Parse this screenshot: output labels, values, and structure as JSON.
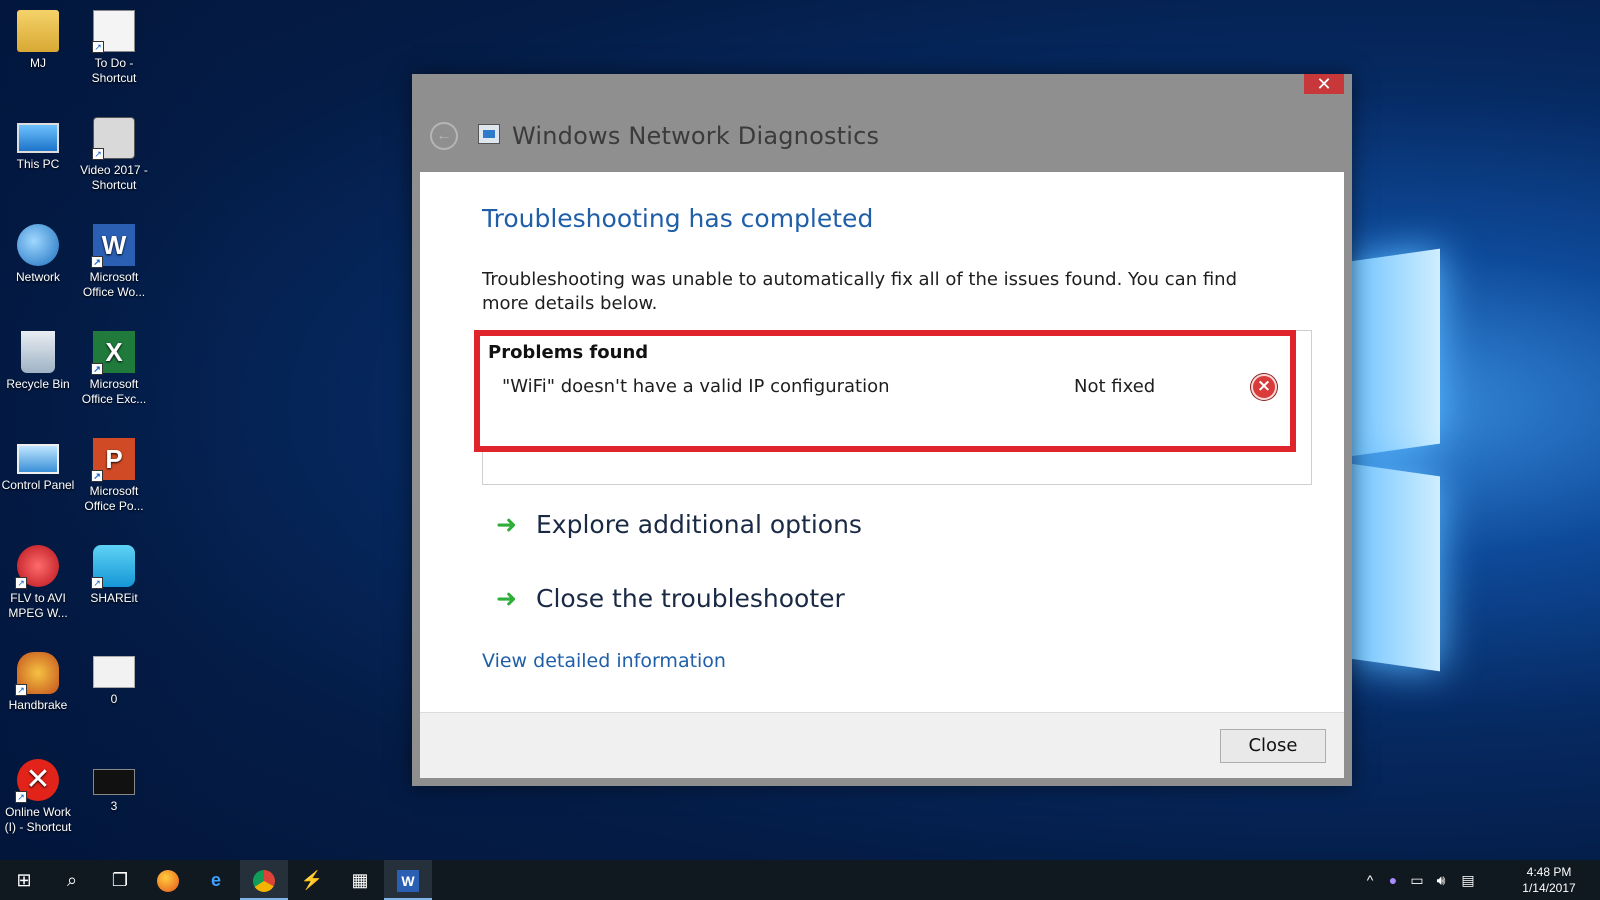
{
  "desktop": {
    "icons": [
      {
        "label": "MJ",
        "icon": "user-folder-icon"
      },
      {
        "label": "To Do - Shortcut",
        "icon": "todo-shortcut-icon"
      },
      {
        "label": "This PC",
        "icon": "computer-icon"
      },
      {
        "label": "Video 2017 - Shortcut",
        "icon": "camera-icon"
      },
      {
        "label": "Network",
        "icon": "network-icon"
      },
      {
        "label": "Microsoft Office Wo...",
        "icon": "word-icon"
      },
      {
        "label": "Recycle Bin",
        "icon": "recycle-bin-icon"
      },
      {
        "label": "Microsoft Office Exc...",
        "icon": "excel-icon"
      },
      {
        "label": "Control Panel",
        "icon": "control-panel-icon"
      },
      {
        "label": "Microsoft Office Po...",
        "icon": "powerpoint-icon"
      },
      {
        "label": "FLV to AVI MPEG W...",
        "icon": "converter-icon"
      },
      {
        "label": "SHAREit",
        "icon": "shareit-icon"
      },
      {
        "label": "Handbrake",
        "icon": "handbrake-icon"
      },
      {
        "label": "0",
        "icon": "file-icon"
      },
      {
        "label": "Online Work (I) - Shortcut",
        "icon": "error-shortcut-icon"
      },
      {
        "label": "3",
        "icon": "file-icon"
      }
    ]
  },
  "dialog": {
    "title": "Windows Network Diagnostics",
    "close_glyph": "✕",
    "back_glyph": "←",
    "heading": "Troubleshooting has completed",
    "description": "Troubleshooting was unable to automatically fix all of the issues found. You can find more details below.",
    "problems_title": "Problems found",
    "problem": {
      "text": "\"WiFi\" doesn't have a valid IP configuration",
      "status": "Not fixed",
      "status_icon": "error-x-icon"
    },
    "options": [
      {
        "label": "Explore additional options",
        "icon": "green-arrow-icon"
      },
      {
        "label": "Close the troubleshooter",
        "icon": "green-arrow-icon"
      }
    ],
    "link": "View detailed information",
    "close_button": "Close"
  },
  "taskbar": {
    "apps": [
      "start-icon",
      "search-icon",
      "task-view-icon",
      "firefox-icon",
      "edge-icon",
      "chrome-icon",
      "winamp-icon",
      "store-icon",
      "word-icon"
    ],
    "time": "4:48 PM",
    "date": "1/14/2017"
  },
  "colors": {
    "accent_blue": "#1f5fa8",
    "highlight_red": "#e0242b",
    "arrow_green": "#2fae3a"
  }
}
